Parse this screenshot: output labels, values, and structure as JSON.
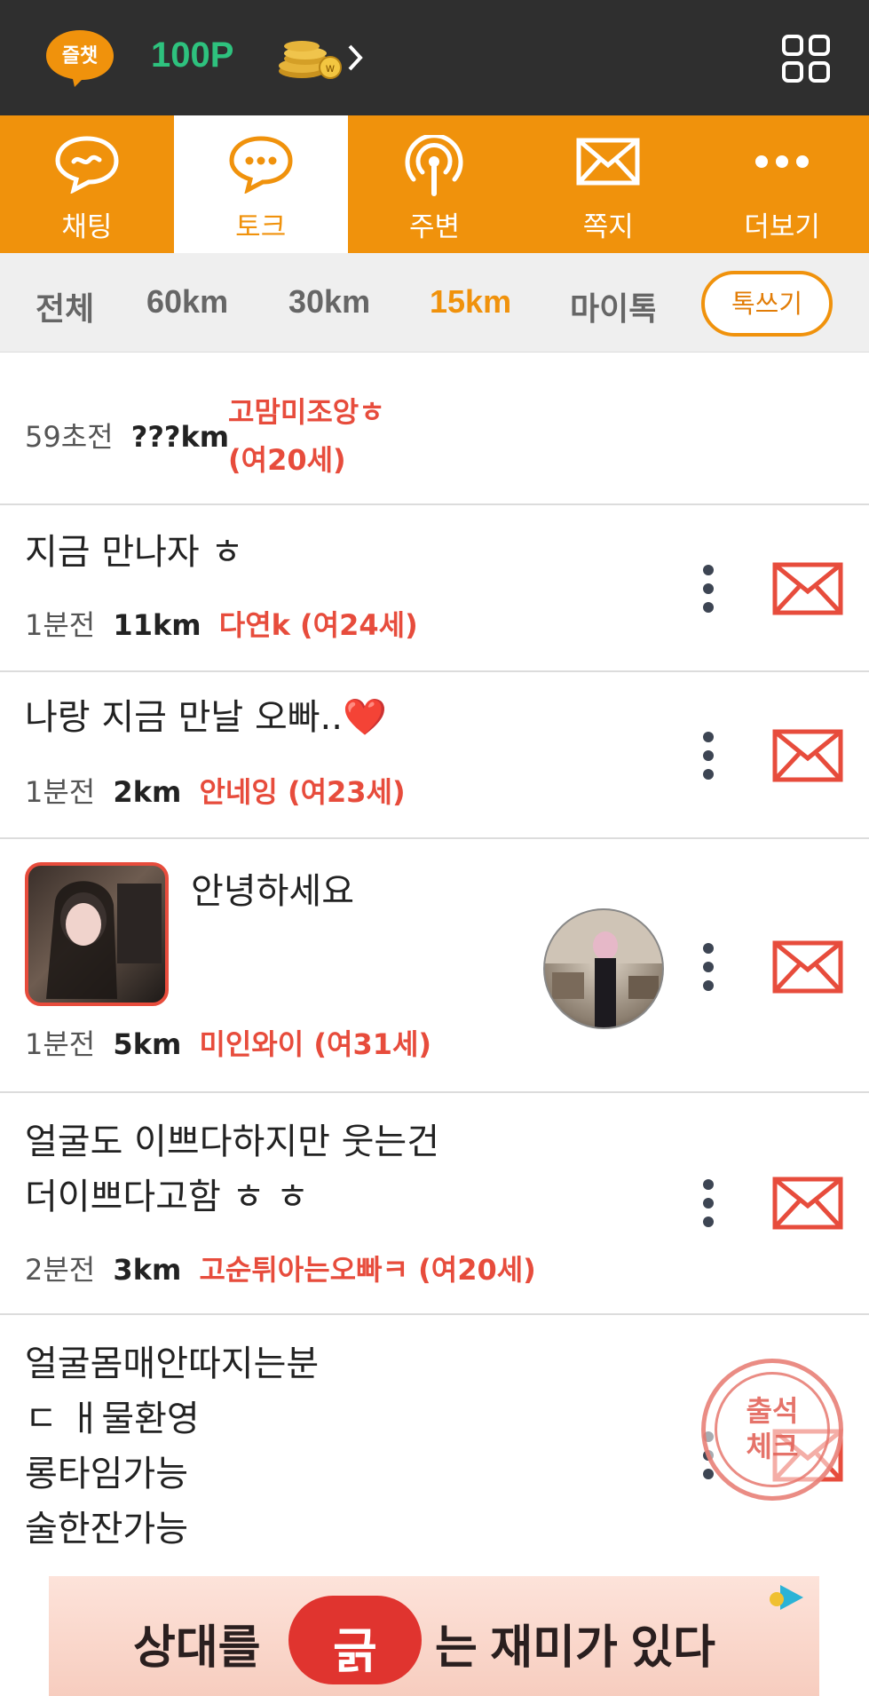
{
  "topbar": {
    "logo_text": "즐챗",
    "points": "100P"
  },
  "tabs": [
    {
      "label": "채팅",
      "icon": "chat-bubble-tilde-icon",
      "active": false
    },
    {
      "label": "토크",
      "icon": "chat-bubble-dots-icon",
      "active": true
    },
    {
      "label": "주변",
      "icon": "broadcast-icon",
      "active": false
    },
    {
      "label": "쪽지",
      "icon": "envelope-icon",
      "active": false
    },
    {
      "label": "더보기",
      "icon": "more-dots-icon",
      "active": false
    }
  ],
  "filters": [
    {
      "label": "전체",
      "active": false
    },
    {
      "label": "60km",
      "active": false
    },
    {
      "label": "30km",
      "active": false
    },
    {
      "label": "15km",
      "active": true
    },
    {
      "label": "마이톡",
      "active": false
    }
  ],
  "write_button": "톡쓰기",
  "posts": [
    {
      "title": "",
      "time": "59초전",
      "distance": "???km",
      "nickname_line1": "고맘미조앙ㅎ",
      "nickname_line2": "(여20세)"
    },
    {
      "title": "지금 만나자 ㅎ",
      "time": "1분전",
      "distance": "11km",
      "nickname": "다연k (여24세)"
    },
    {
      "title": "나랑 지금 만날 오빠..❤️",
      "time": "1분전",
      "distance": "2km",
      "nickname": "안네잉 (여23세)"
    },
    {
      "title": "안녕하세요",
      "time": "1분전",
      "distance": "5km",
      "nickname": "미인와이 (여31세)"
    },
    {
      "title_line1": "얼굴도 이쁘다하지만 웃는건",
      "title_line2": "더이쁘다고함 ㅎ ㅎ",
      "time": "2분전",
      "distance": "3km",
      "nickname": "고순튀아는오빠ㅋ (여20세)"
    },
    {
      "title_line1": "얼굴몸매안따지는분",
      "title_line2": "ㄷ ㅐ물환영",
      "title_line3": "롱타임가능",
      "title_line4": "술한잔가능"
    }
  ],
  "attendance_stamp": {
    "line1": "출석",
    "line2": "체크"
  },
  "banner": {
    "text_left": "상대를",
    "badge": "긁",
    "text_right": "는 재미가 있다"
  },
  "colors": {
    "accent": "#f0920c",
    "topbar": "#2f2f2f",
    "points": "#2ec27e",
    "nickname": "#e74c3c",
    "mail": "#e74c3c"
  }
}
